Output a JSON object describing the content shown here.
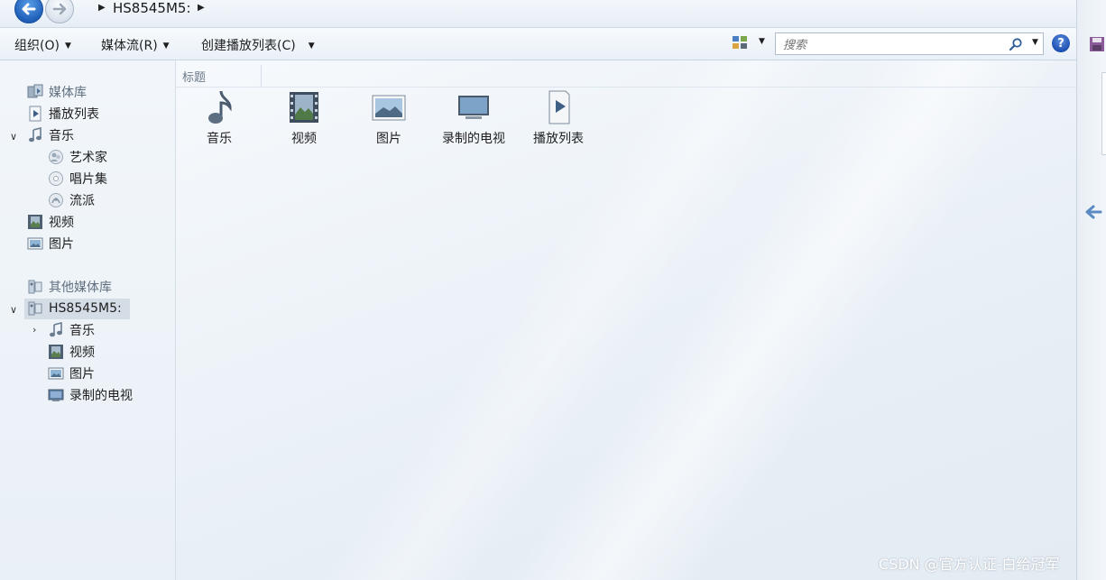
{
  "address_bar": {
    "breadcrumb_device": "HS8545M5:"
  },
  "toolbar": {
    "organize_label": "组织(O)",
    "stream_label": "媒体流(R)",
    "create_playlist_label": "创建播放列表(C)",
    "search_placeholder": "搜索"
  },
  "sidebar": {
    "library": "媒体库",
    "playlists": "播放列表",
    "music": "音乐",
    "artists": "艺术家",
    "albums": "唱片集",
    "genres": "流派",
    "videos": "视频",
    "pictures": "图片",
    "other_libraries": "其他媒体库",
    "device": "HS8545M5:",
    "device_music": "音乐",
    "device_videos": "视频",
    "device_pictures": "图片",
    "device_tv": "录制的电视"
  },
  "content": {
    "column_header": "标题",
    "tiles": [
      "音乐",
      "视频",
      "图片",
      "录制的电视",
      "播放列表"
    ]
  },
  "watermark": "CSDN @官方认证-白给冠军",
  "colors": {
    "accent": "#1f5fb8",
    "background": "#eef3f8"
  }
}
